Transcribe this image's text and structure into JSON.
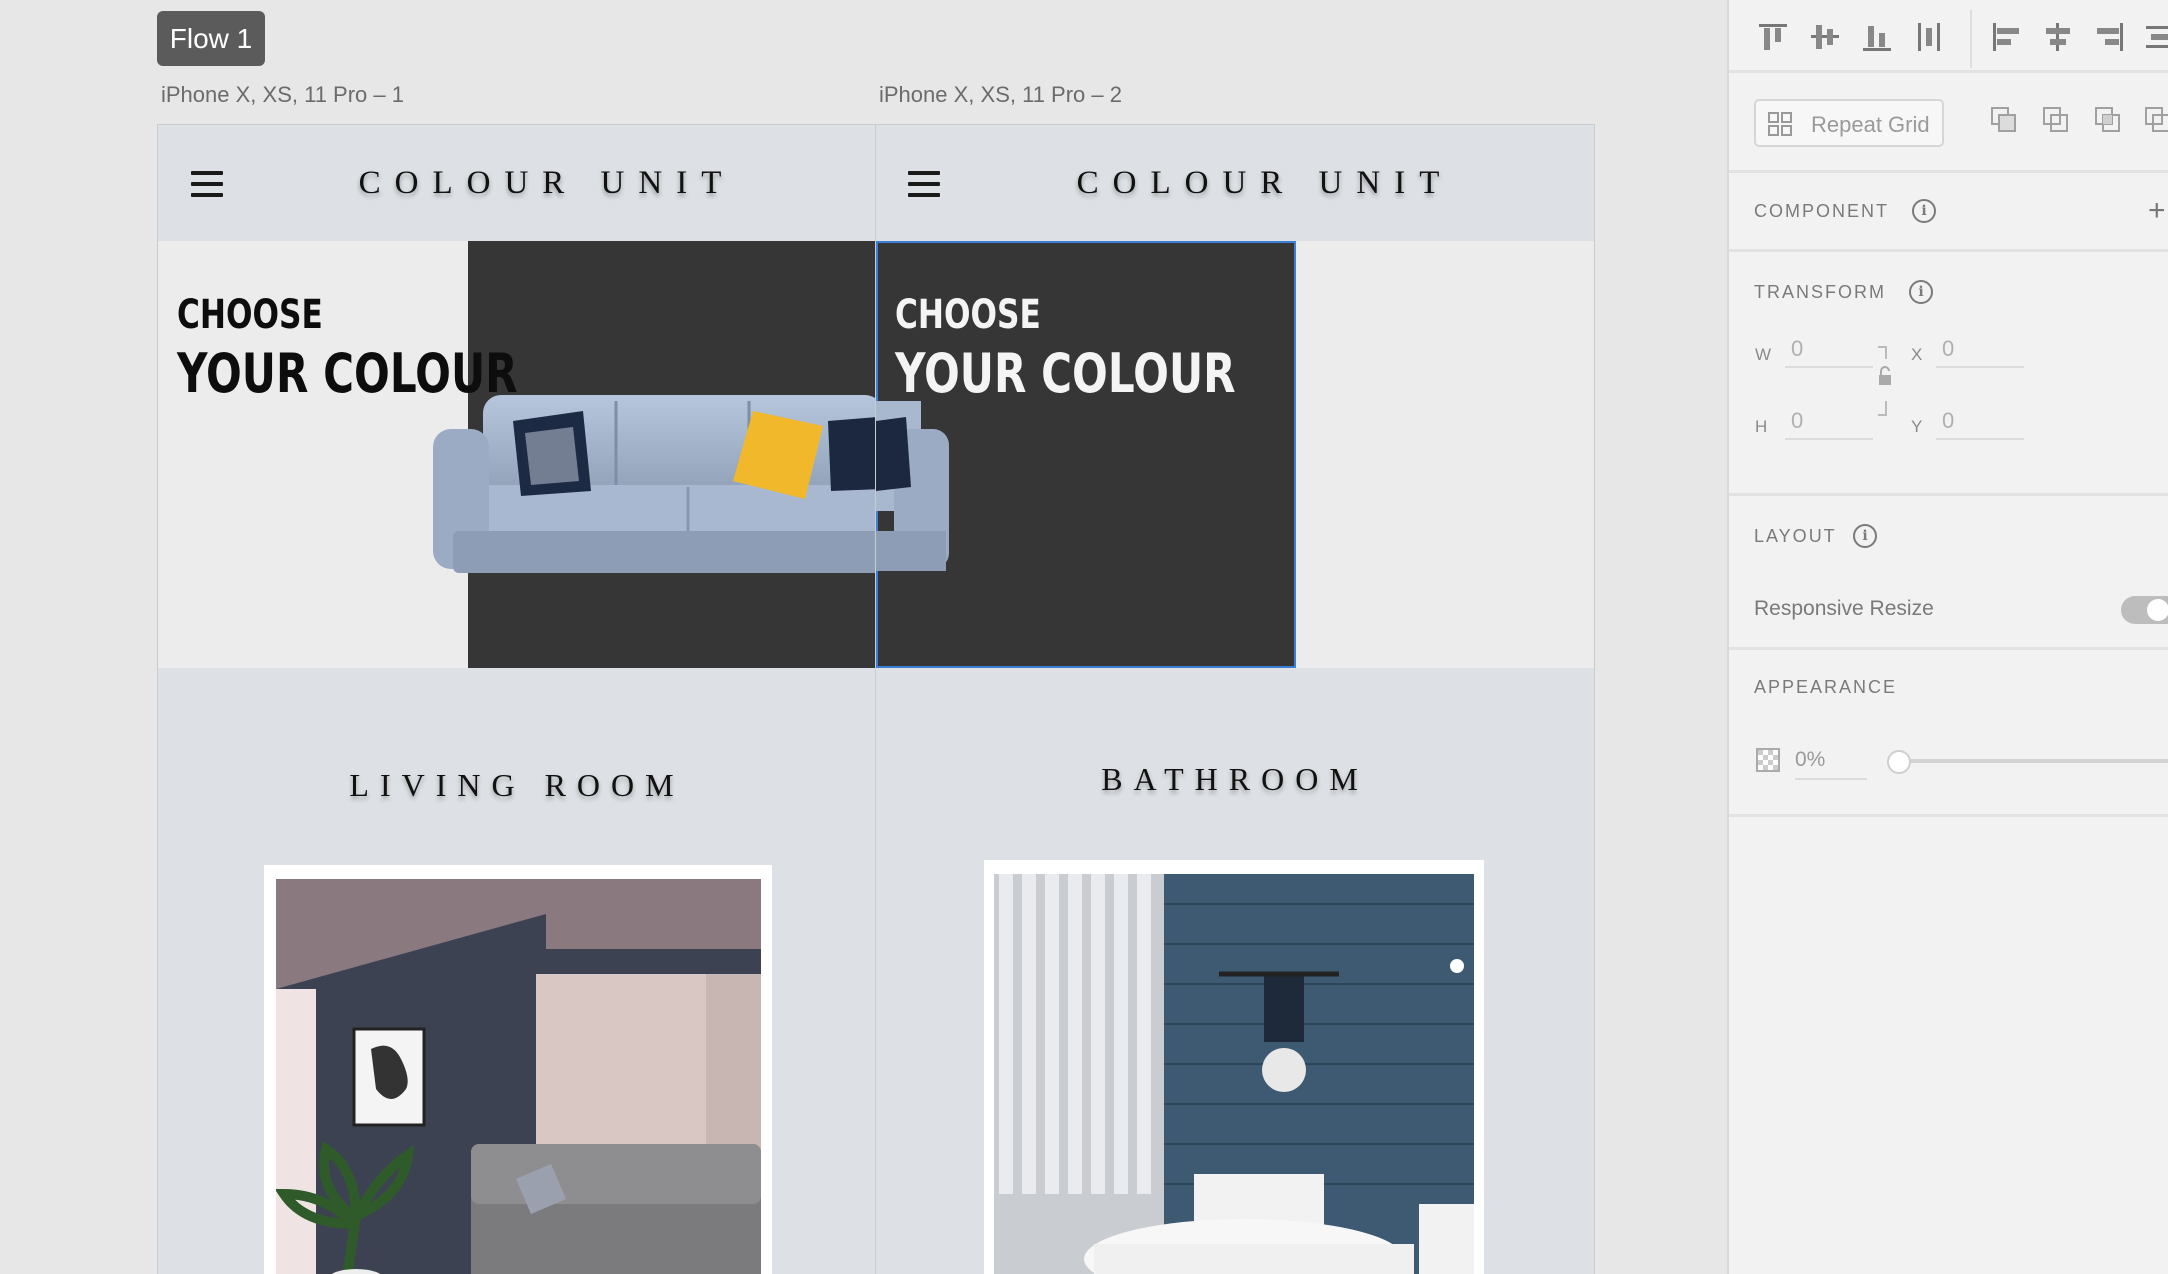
{
  "flow": {
    "label": "Flow 1"
  },
  "artboards": [
    {
      "label": "iPhone X, XS, 11 Pro – 1",
      "brand": "COLOUR UNIT",
      "hero_line1": "CHOOSE",
      "hero_line2": "YOUR COLOUR",
      "section_title": "LIVING ROOM"
    },
    {
      "label": "iPhone X, XS, 11 Pro – 2",
      "brand": "COLOUR UNIT",
      "hero_line1": "CHOOSE",
      "hero_line2": "YOUR COLOUR",
      "section_title": "BATHROOM"
    }
  ],
  "panel": {
    "repeat_grid": "Repeat Grid",
    "component": "COMPONENT",
    "transform": "TRANSFORM",
    "w_label": "W",
    "w_value": "0",
    "h_label": "H",
    "h_value": "0",
    "x_label": "X",
    "x_value": "0",
    "y_label": "Y",
    "y_value": "0",
    "layout": "LAYOUT",
    "responsive_resize": "Responsive Resize",
    "appearance": "APPEARANCE",
    "opacity_value": "0%",
    "opacity_level": 0
  },
  "colors": {
    "canvas": "#e7e7e7",
    "artboard": "#dde1e5",
    "hero_dark": "#363636",
    "selection": "#3b7fd6",
    "flow_tag": "#5b5b5b"
  },
  "icons": [
    "hamburger-icon",
    "info-icon",
    "plus-icon",
    "lock-icon",
    "repeat-grid-icon",
    "align-top-icon",
    "align-middle-icon",
    "align-bottom-icon",
    "distribute-vertical-icon",
    "align-left-icon",
    "align-center-icon",
    "align-right-icon",
    "distribute-horizontal-icon",
    "boolean-add-icon",
    "boolean-subtract-icon",
    "boolean-intersect-icon",
    "boolean-exclude-icon",
    "opacity-checker-icon"
  ]
}
